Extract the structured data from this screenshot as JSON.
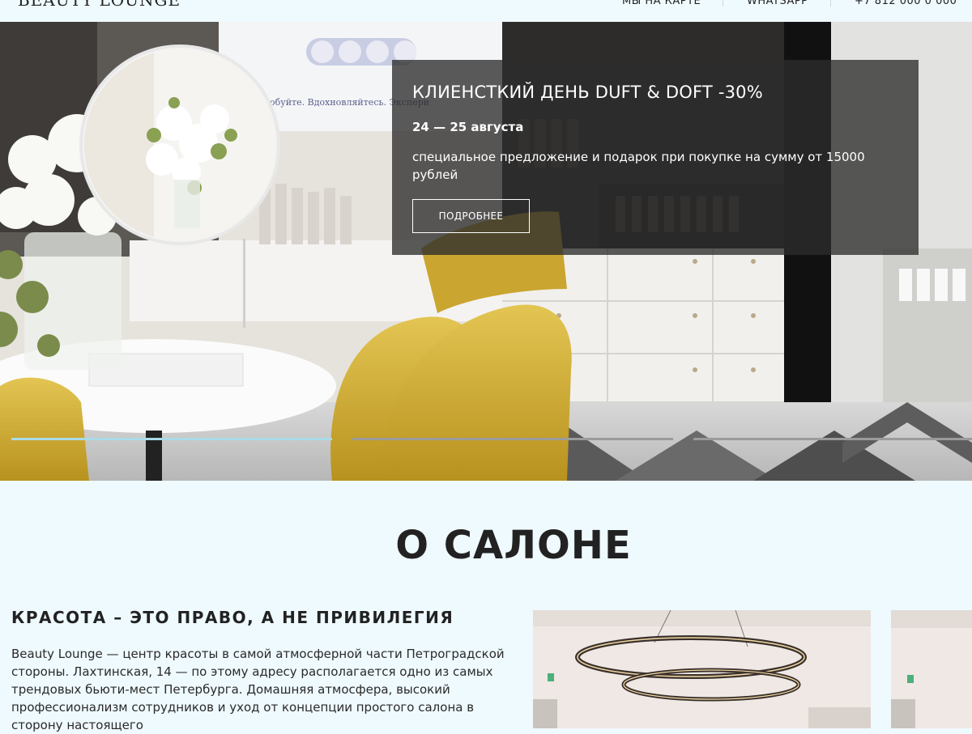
{
  "brand": {
    "logo": "BEAUTY LOUNGE"
  },
  "nav": {
    "map": "МЫ НА КАРТЕ",
    "whatsapp": "WHATSAPP",
    "phone": "+7 812 000 0 000"
  },
  "promo": {
    "title": "КЛИЕНСТКИЙ ДЕНЬ DUFT & DOFT -30%",
    "date": "24 — 25 августа",
    "text": "специальное предложение и подарок при покупке на сумму от 15000 рублей",
    "button": "ПОДРОБНЕЕ"
  },
  "hero_screen_text": "обуйте. Вдохновляйтесь. Экспери",
  "slider": {
    "active_index": 0,
    "count": 3,
    "colors": {
      "active": "#a9dbe9",
      "inactive": "#9b9b9b"
    }
  },
  "about": {
    "title": "О САЛОНЕ",
    "subtitle": "КРАСОТА – ЭТО ПРАВО, А НЕ ПРИВИЛЕГИЯ",
    "text": "Beauty Lounge — центр красоты в самой атмосферной части Петроградской стороны. Лахтинская, 14 — по этому адресу располагается одно из самых трендовых бьюти-мест Петербурга. Домашняя атмосфера, высокий профессионализм сотрудников и уход от концепции простого салона в сторону настоящего"
  },
  "colors": {
    "background": "#effaff",
    "text": "#222222",
    "accent": "#a9dbe9",
    "chair": "#d4b13a"
  }
}
